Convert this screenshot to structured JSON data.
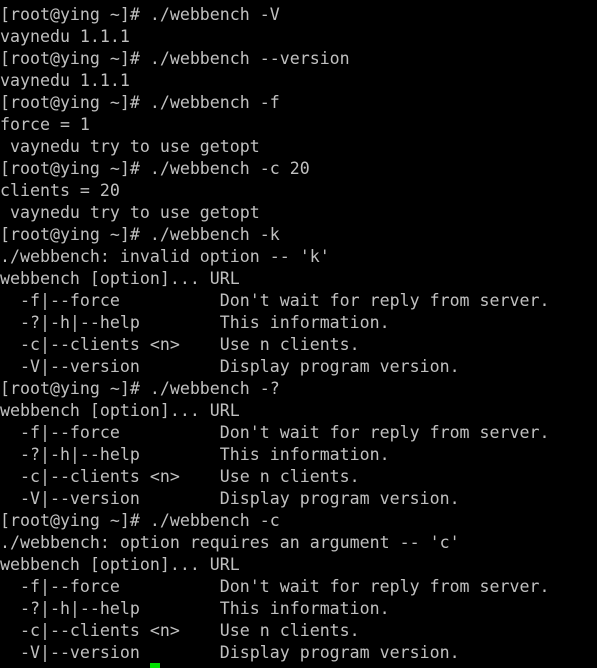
{
  "terminal": {
    "lines": [
      "[root@ying ~]# ./webbench -V",
      "vaynedu 1.1.1",
      "[root@ying ~]# ./webbench --version",
      "vaynedu 1.1.1",
      "[root@ying ~]# ./webbench -f",
      "force = 1",
      " vaynedu try to use getopt",
      "[root@ying ~]# ./webbench -c 20",
      "clients = 20",
      " vaynedu try to use getopt",
      "[root@ying ~]# ./webbench -k",
      "./webbench: invalid option -- 'k'",
      "webbench [option]... URL",
      "  -f|--force          Don't wait for reply from server.",
      "  -?|-h|--help        This information.",
      "  -c|--clients <n>    Use n clients.",
      "  -V|--version        Display program version.",
      "[root@ying ~]# ./webbench -?",
      "webbench [option]... URL",
      "  -f|--force          Don't wait for reply from server.",
      "  -?|-h|--help        This information.",
      "  -c|--clients <n>    Use n clients.",
      "  -V|--version        Display program version.",
      "[root@ying ~]# ./webbench -c",
      "./webbench: option requires an argument -- 'c'",
      "webbench [option]... URL",
      "  -f|--force          Don't wait for reply from server.",
      "  -?|-h|--help        This information.",
      "  -c|--clients <n>    Use n clients.",
      "  -V|--version        Display program version."
    ],
    "text_color": "#c0c0c0",
    "background": "#000000",
    "cursor_color": "#00e000"
  }
}
